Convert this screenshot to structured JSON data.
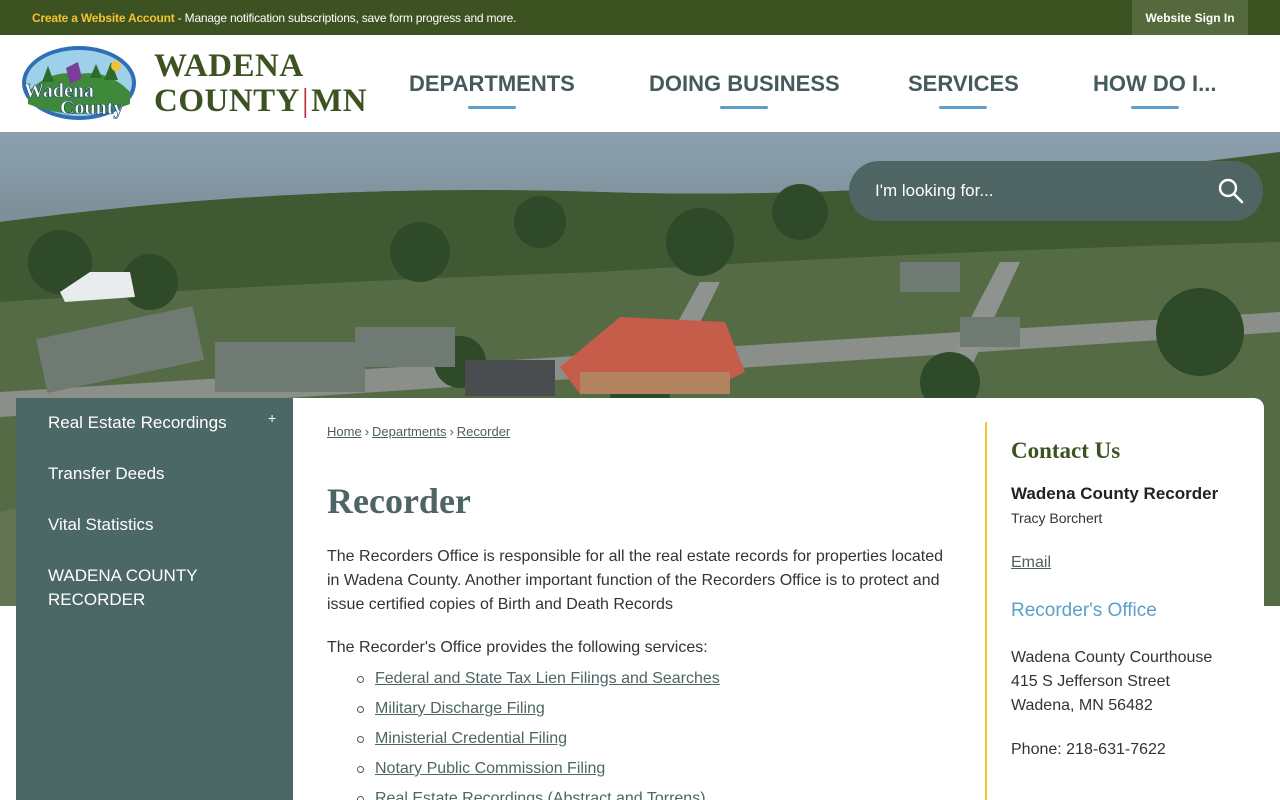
{
  "topbar": {
    "create_link": "Create a Website Account",
    "create_text": " - Manage notification subscriptions, save form progress and more.",
    "signin": "Website Sign In"
  },
  "header": {
    "logo_text_line1": "Wadena",
    "logo_text_line2": "County",
    "wordmark_line1": "WADENA",
    "wordmark_line2_a": "COUNTY",
    "wordmark_line2_b": "MN",
    "nav": [
      "DEPARTMENTS",
      "DOING BUSINESS",
      "SERVICES",
      "HOW DO I..."
    ]
  },
  "search": {
    "placeholder": "I'm looking for..."
  },
  "sidebar": {
    "items": [
      "Real Estate Recordings",
      "Transfer Deeds",
      "Vital Statistics",
      "WADENA COUNTY RECORDER"
    ],
    "expand_symbol": "+"
  },
  "breadcrumb": [
    "Home",
    "Departments",
    "Recorder"
  ],
  "main": {
    "title": "Recorder",
    "intro": "The Recorders Office is responsible for all the real estate records for properties located in Wadena County.  Another important function of the Recorders Office is to protect and issue certified copies of Birth and Death Records",
    "services_lead": "The Recorder's Office provides the following services:",
    "services": [
      "Federal and State Tax Lien Filings and Searches",
      "Military Discharge Filing",
      "Ministerial Credential Filing",
      "Notary Public Commission Filing",
      "Real Estate Recordings (Abstract and Torrens)"
    ]
  },
  "contact": {
    "heading": "Contact Us",
    "org": "Wadena County Recorder",
    "person": "Tracy Borchert",
    "email": "Email",
    "office": "Recorder's Office",
    "address": [
      "Wadena County Courthouse",
      "415 S Jefferson Street",
      "Wadena, MN 56482"
    ],
    "phone": "Phone: 218-631-7622"
  },
  "colors": {
    "topbar": "#3d5221",
    "accent_yellow": "#f2c230",
    "nav_text": "#455a5c",
    "nav_underline": "#5ba0c8",
    "sidebar": "#4b6766",
    "search_bg": "#4e6564"
  }
}
